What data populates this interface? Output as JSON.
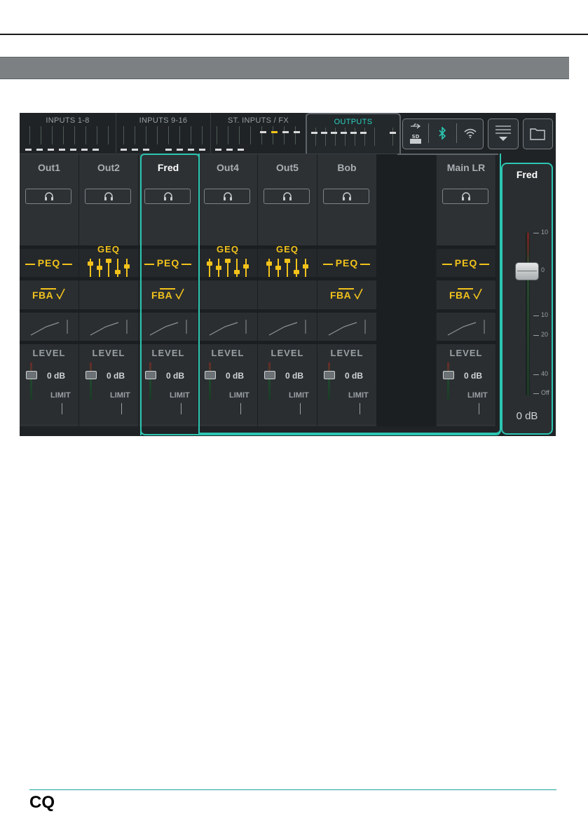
{
  "tabs": {
    "inputs_1_8": "INPUTS 1-8",
    "inputs_9_16": "INPUTS 9-16",
    "st_inputs_fx": "ST. INPUTS / FX",
    "outputs": "OUTPUTS"
  },
  "status_icons": [
    "usb-icon",
    "sd-card-icon",
    "bluetooth-icon",
    "wifi-icon"
  ],
  "strips": [
    {
      "name": "Out1",
      "process": "PEQ",
      "fba": "FBA",
      "level_label": "LEVEL",
      "level_value": "0 dB",
      "limit_label": "LIMIT"
    },
    {
      "name": "Out2",
      "process": "GEQ",
      "fba": "",
      "level_label": "LEVEL",
      "level_value": "0 dB",
      "limit_label": "LIMIT"
    },
    {
      "name": "Fred",
      "process": "PEQ",
      "fba": "FBA",
      "level_label": "LEVEL",
      "level_value": "0 dB",
      "limit_label": "LIMIT"
    },
    {
      "name": "Out4",
      "process": "GEQ",
      "fba": "",
      "level_label": "LEVEL",
      "level_value": "0 dB",
      "limit_label": "LIMIT"
    },
    {
      "name": "Out5",
      "process": "GEQ",
      "fba": "",
      "level_label": "LEVEL",
      "level_value": "0 dB",
      "limit_label": "LIMIT"
    },
    {
      "name": "Bob",
      "process": "PEQ",
      "fba": "FBA",
      "level_label": "LEVEL",
      "level_value": "0 dB",
      "limit_label": "LIMIT"
    },
    {
      "name": "Main LR",
      "process": "PEQ",
      "fba": "FBA",
      "level_label": "LEVEL",
      "level_value": "0 dB",
      "limit_label": "LIMIT"
    }
  ],
  "fader_panel": {
    "name": "Fred",
    "value": "0 dB",
    "scale": [
      "10",
      "0",
      "10",
      "20",
      "40",
      "Off"
    ]
  },
  "footer": {
    "logo": "CQ"
  },
  "colors": {
    "accent": "#2cc6b2",
    "process": "#f2c21b",
    "background": "#1f2326"
  }
}
